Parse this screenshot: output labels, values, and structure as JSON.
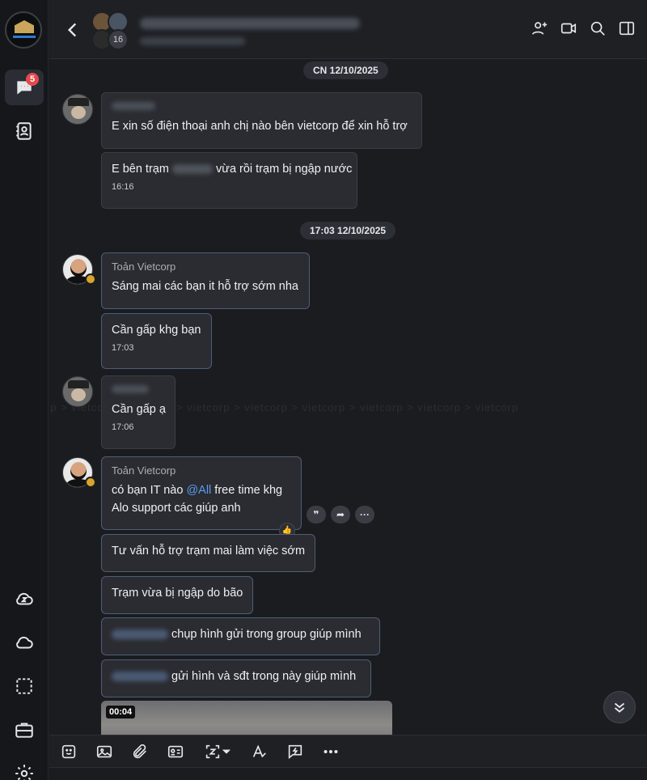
{
  "nav": {
    "chat_badge": "5",
    "items": [
      "messages-icon",
      "contacts-icon",
      "cloud-sync-icon",
      "cloud-icon",
      "screenshot-icon",
      "toolbox-icon",
      "settings-icon"
    ]
  },
  "header": {
    "member_avatar_count": "16",
    "icons": [
      "add-member-icon",
      "video-call-icon",
      "search-icon",
      "side-panel-icon"
    ]
  },
  "chat": {
    "watermark": "vietcorp >  vietcorp >  vietcorp >  vietcorp >  vietcorp >  vietcorp >  vietcorp >  vietcorp >  vietcorp",
    "dates": [
      "CN 12/10/2025",
      "17:03 12/10/2025"
    ],
    "messages": [
      {
        "sender": "",
        "text": "E xin số điện thoại anh chị nào bên vietcorp để xin hỗ trợ",
        "time": ""
      },
      {
        "sender": "",
        "text_before": "E bên trạm ",
        "text_after": " vừa rồi trạm bị ngập nước",
        "time": "16:16"
      },
      {
        "sender": "Toản Vietcorp",
        "text": "Sáng mai các bạn it hỗ trợ sớm nha",
        "time": ""
      },
      {
        "sender": "",
        "text": "Cần gấp khg bạn",
        "time": "17:03"
      },
      {
        "sender": "",
        "text": "Cần gấp ạ",
        "time": "17:06"
      },
      {
        "sender": "Toản Vietcorp",
        "line1_before": "có bạn IT nào ",
        "mention": "@All",
        "line1_after": "  free time khg",
        "line2": "Alo support các giúp anh",
        "time": ""
      },
      {
        "sender": "",
        "text": "Tư vấn hỗ trợ trạm mai làm việc sớm",
        "time": ""
      },
      {
        "sender": "",
        "text": "Trạm vừa bị ngập do bão",
        "time": ""
      },
      {
        "sender": "",
        "text_after": "chụp hình gửi trong group giúp mình",
        "time": ""
      },
      {
        "sender": "",
        "text_after": "gửi hình và sđt trong này giúp mình",
        "time": ""
      }
    ],
    "video_duration": "00:04"
  },
  "toolbar": {
    "icons": [
      "sticker-icon",
      "image-icon",
      "attachment-icon",
      "contact-card-icon",
      "capture-icon",
      "text-format-icon",
      "quick-message-icon",
      "more-icon"
    ]
  }
}
